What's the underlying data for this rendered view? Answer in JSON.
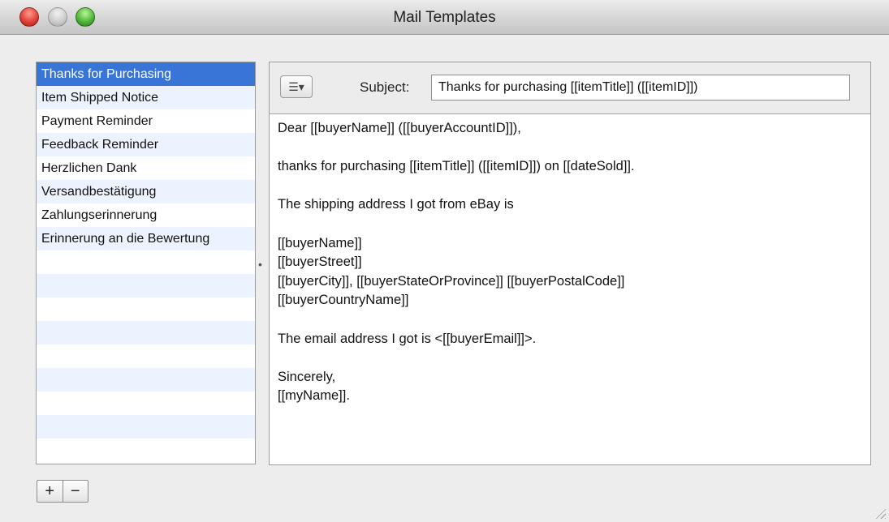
{
  "window": {
    "title": "Mail Templates"
  },
  "templates": [
    {
      "label": "Thanks for Purchasing",
      "selected": true
    },
    {
      "label": "Item Shipped Notice"
    },
    {
      "label": "Payment Reminder"
    },
    {
      "label": "Feedback Reminder"
    },
    {
      "label": "Herzlichen Dank"
    },
    {
      "label": "Versandbestätigung"
    },
    {
      "label": "Zahlungserinnerung"
    },
    {
      "label": "Erinnerung an die Bewertung"
    }
  ],
  "editor": {
    "menu_icon": "list-menu-icon",
    "menu_glyph": "☰▾",
    "subject_label": "Subject:",
    "subject_value": "Thanks for purchasing [[itemTitle]] ([[itemID]])",
    "body_lines": [
      "Dear [[buyerName]] ([[buyerAccountID]]),",
      "",
      "thanks for purchasing [[itemTitle]] ([[itemID]]) on [[dateSold]].",
      "",
      "The shipping address I got from eBay is",
      "",
      "[[buyerName]]",
      "[[buyerStreet]]",
      "[[buyerCity]], [[buyerStateOrProvince]] [[buyerPostalCode]]",
      "[[buyerCountryName]]",
      "",
      "The email address I got is <[[buyerEmail]]>.",
      "",
      "Sincerely,",
      "[[myName]]."
    ]
  },
  "buttons": {
    "add_label": "+",
    "remove_label": "−"
  },
  "colors": {
    "selection": "#3875d7",
    "alt_row": "#edf3fe"
  }
}
